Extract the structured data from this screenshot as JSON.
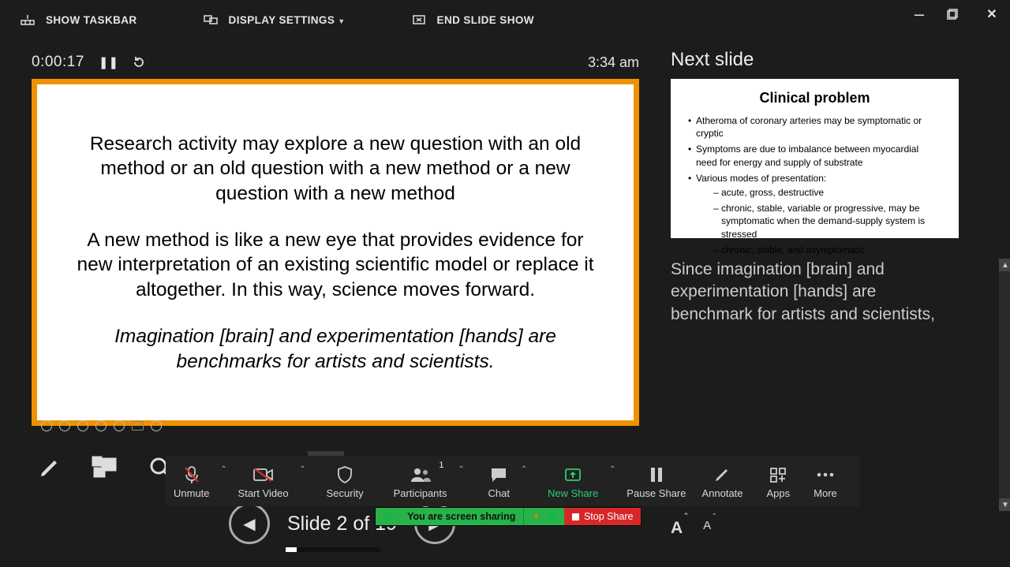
{
  "toolbar": {
    "show_taskbar": "SHOW TASKBAR",
    "display_settings": "DISPLAY SETTINGS",
    "end_show": "END SLIDE SHOW"
  },
  "timer": {
    "elapsed": "0:00:17",
    "clock": "3:34 am"
  },
  "current_slide": {
    "p1": "Research activity may explore a new question with an old method or an old question with a new method or a new question with a new method",
    "p2": "A new method is like a new eye that provides evidence for new interpretation of an existing scientific model or replace it altogether. In this way, science moves forward.",
    "p3": "Imagination [brain] and experimentation [hands] are benchmarks for artists and scientists."
  },
  "slide_counter": "Slide 2 of 19",
  "next_slide": {
    "panel_title": "Next slide",
    "title": "Clinical problem",
    "b1": "Atheroma of coronary arteries may be symptomatic or cryptic",
    "b2": "Symptoms are due to imbalance between myocardial need for energy and supply of substrate",
    "b3": "Various modes of presentation:",
    "b3a": "acute, gross, destructive",
    "b3b": "chronic, stable, variable or progressive, may be symptomatic when the demand-supply system is stressed",
    "b3c": "chronic, stable, and asymptomatic"
  },
  "notes": {
    "text": "Since imagination [brain] and experimentation [hands] are benchmark for artists and scientists,"
  },
  "zoom": {
    "unmute": "Unmute",
    "start_video": "Start Video",
    "security": "Security",
    "participants": "Participants",
    "participants_count": "1",
    "chat": "Chat",
    "new_share": "New Share",
    "pause_share": "Pause Share",
    "annotate": "Annotate",
    "apps": "Apps",
    "more": "More"
  },
  "share_strip": {
    "status": "You are screen sharing",
    "stop": "Stop Share"
  }
}
